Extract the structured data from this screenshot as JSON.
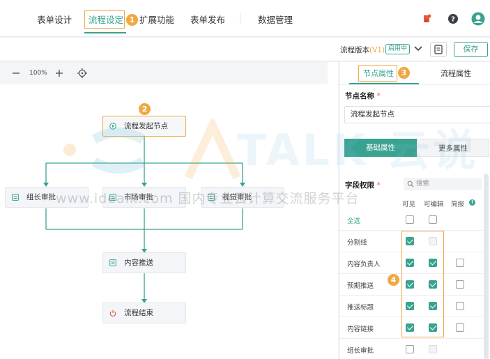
{
  "topnav": {
    "tabs": [
      {
        "label": "表单设计",
        "active": false
      },
      {
        "label": "流程设定",
        "active": true
      },
      {
        "label": "扩展功能",
        "active": false
      },
      {
        "label": "表单发布",
        "active": false
      },
      {
        "label": "数据管理",
        "active": false
      }
    ],
    "icons": [
      "ticket-icon",
      "help-circle-icon",
      "user-avatar-icon"
    ]
  },
  "toolbar": {
    "version_label": "流程版本",
    "version_num": "(V1)",
    "status_tag": "启用中",
    "save_label": "保存"
  },
  "canvas": {
    "zoom": "100%",
    "nodes": {
      "start": "流程发起节点",
      "leader": "组长审批",
      "market": "市场审批",
      "visual": "视觉审批",
      "push": "内容推送",
      "end": "流程结束"
    }
  },
  "panel": {
    "tabs": [
      "节点属性",
      "流程属性"
    ],
    "node_name_label": "节点名称",
    "required_mark": "*",
    "node_name_value": "流程发起节点",
    "segments": [
      "基础属性",
      "更多属性"
    ],
    "field_perm_label": "字段权限",
    "search_placeholder": "搜索",
    "columns": [
      "可见",
      "可编辑",
      "简报"
    ],
    "rows": [
      {
        "label": "全选",
        "visible": "unchecked",
        "editable": "unchecked",
        "brief": "none"
      },
      {
        "label": "分割线",
        "visible": "checked",
        "editable": "disabled",
        "brief": "none"
      },
      {
        "label": "内容负责人",
        "visible": "checked",
        "editable": "checked",
        "brief": "unchecked"
      },
      {
        "label": "预期推送",
        "visible": "checked",
        "editable": "checked",
        "brief": "unchecked"
      },
      {
        "label": "推送标题",
        "visible": "checked",
        "editable": "checked",
        "brief": "unchecked"
      },
      {
        "label": "内容链接",
        "visible": "checked",
        "editable": "checked",
        "brief": "unchecked"
      },
      {
        "label": "组长审批",
        "visible": "unchecked",
        "editable": "disabled",
        "brief": "none"
      }
    ]
  },
  "badges": [
    "1",
    "2",
    "3",
    "4"
  ],
  "watermark": {
    "big": "TALK 云说",
    "line": "www.idealk.com 国内专业云计算交流服务平台"
  },
  "colors": {
    "accent": "#3aa290",
    "highlight": "#f0a843"
  }
}
